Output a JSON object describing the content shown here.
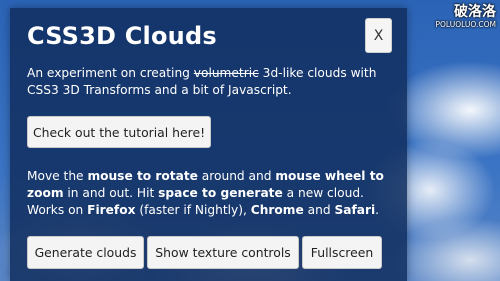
{
  "page": {
    "title": "CSS3D Clouds",
    "close_label": "X"
  },
  "intro": {
    "pre": "An experiment on creating ",
    "struck": "volumetric",
    "post": " 3d-like clouds with CSS3 3D Transforms and a bit of Javascript."
  },
  "tutorial_button": "Check out the tutorial here!",
  "instructions": {
    "t1": "Move the ",
    "b1": "mouse to rotate",
    "t2": " around and ",
    "b2": "mouse wheel to zoom",
    "t3": " in and out. Hit ",
    "b3": "space to generate",
    "t4": " a new cloud. Works on ",
    "b4": "Firefox",
    "t5": " (faster if Nightly), ",
    "b5": "Chrome",
    "t6": " and ",
    "b6": "Safari",
    "t7": "."
  },
  "buttons": {
    "generate": "Generate clouds",
    "texture": "Show texture controls",
    "fullscreen": "Fullscreen"
  },
  "watermark": {
    "cn": "破洛洛",
    "en": "POLUOLUO.COM"
  }
}
